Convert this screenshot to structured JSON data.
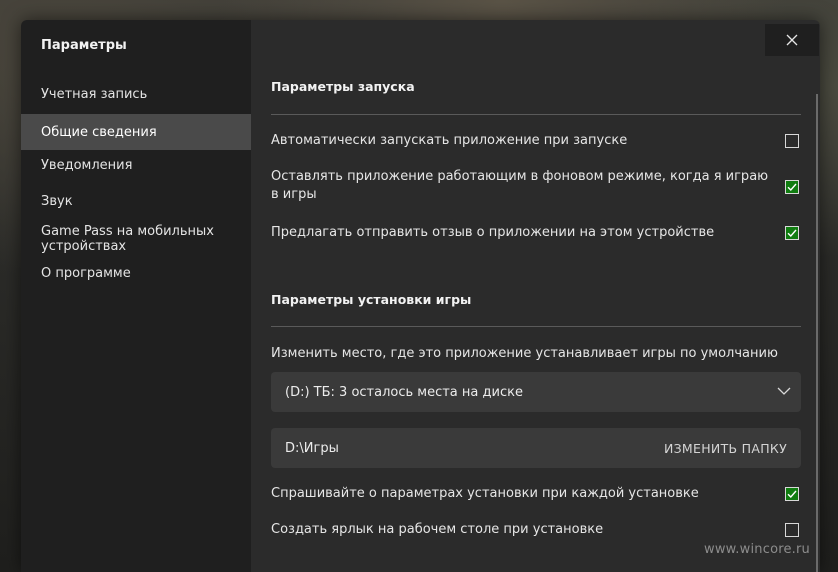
{
  "sidebar": {
    "title": "Параметры",
    "items": [
      {
        "label": "Учетная запись"
      },
      {
        "label": "Общие сведения"
      },
      {
        "label": "Уведомления"
      },
      {
        "label": "Звук"
      },
      {
        "label": "Game Pass на мобильных устройствах"
      },
      {
        "label": "О программе"
      }
    ],
    "active_index": 1
  },
  "main": {
    "launch": {
      "title": "Параметры запуска",
      "options": [
        {
          "label": "Автоматически запускать приложение при запуске",
          "checked": false
        },
        {
          "label": "Оставлять приложение работающим в фоновом режиме, когда я играю в игры",
          "checked": true
        },
        {
          "label": "Предлагать отправить отзыв о приложении на этом устройстве",
          "checked": true
        }
      ]
    },
    "install": {
      "title": "Параметры установки игры",
      "location_label": "Изменить место, где это приложение устанавливает игры по умолчанию",
      "drive_selected": "(D:) ТБ: 3 осталось места на диске",
      "folder_path": "D:\\Игры",
      "change_folder_label": "ИЗМЕНИТЬ ПАПКУ",
      "options": [
        {
          "label": "Спрашивайте о параметрах установки при каждой установке",
          "checked": true
        },
        {
          "label": "Создать ярлык на рабочем столе при установке",
          "checked": false
        }
      ]
    }
  },
  "watermark": "www.wincore.ru",
  "colors": {
    "sidebar_bg": "#1f1f1f",
    "main_bg": "#2b2b2b",
    "active_item_bg": "#4a4a4a",
    "checkbox_checked": "#107c10"
  },
  "icons": {
    "close": "close-icon",
    "checkmark": "checkmark-icon",
    "chevron": "chevron-down-icon"
  }
}
